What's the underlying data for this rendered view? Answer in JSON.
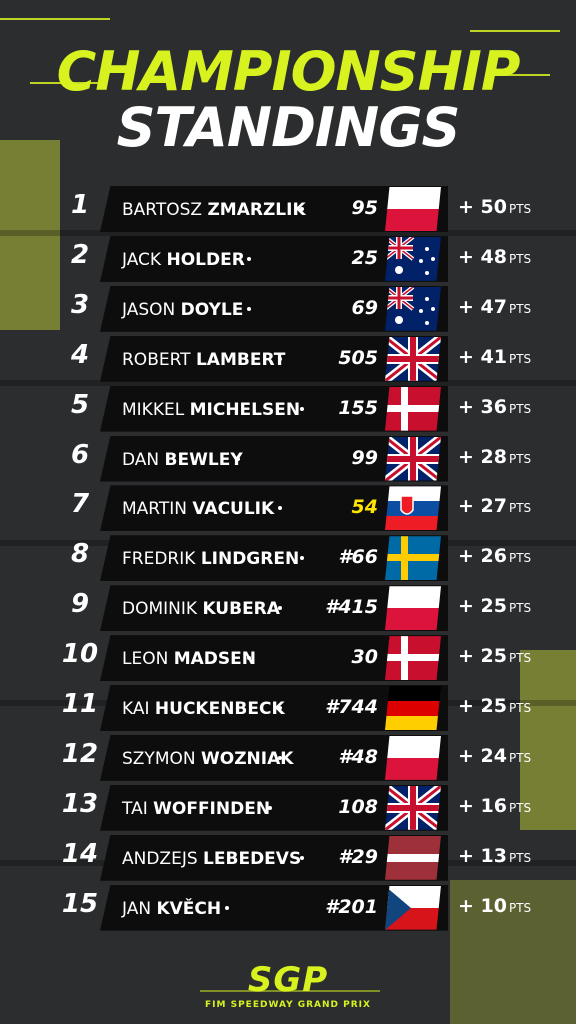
{
  "header": {
    "line1": "CHAMPIONSHIP",
    "line2": "STANDINGS"
  },
  "colors": {
    "accent": "#d7f21f",
    "bar": "#0d0d0d",
    "background": "#2b2d2f"
  },
  "standings": [
    {
      "rank": "1",
      "first": "BARTOSZ",
      "last": "ZMARZLIK",
      "number": "95",
      "flag": "poland",
      "points": "+ 50",
      "unit": "PTS"
    },
    {
      "rank": "2",
      "first": "JACK",
      "last": "HOLDER",
      "number": "25",
      "flag": "australia",
      "points": "+ 48",
      "unit": "PTS"
    },
    {
      "rank": "3",
      "first": "JASON",
      "last": "DOYLE",
      "number": "69",
      "flag": "australia",
      "points": "+ 47",
      "unit": "PTS"
    },
    {
      "rank": "4",
      "first": "ROBERT",
      "last": "LAMBERT",
      "number": "505",
      "flag": "uk",
      "points": "+ 41",
      "unit": "PTS"
    },
    {
      "rank": "5",
      "first": "MIKKEL",
      "last": "MICHELSEN",
      "number": "155",
      "flag": "denmark",
      "points": "+ 36",
      "unit": "PTS"
    },
    {
      "rank": "6",
      "first": "DAN",
      "last": "BEWLEY",
      "number": "99",
      "flag": "uk",
      "points": "+ 28",
      "unit": "PTS"
    },
    {
      "rank": "7",
      "first": "MARTIN",
      "last": "VACULIK",
      "number": "54",
      "flag": "slovakia",
      "points": "+ 27",
      "unit": "PTS"
    },
    {
      "rank": "8",
      "first": "FREDRIK",
      "last": "LINDGREN",
      "number": "#66",
      "flag": "sweden",
      "points": "+ 26",
      "unit": "PTS"
    },
    {
      "rank": "9",
      "first": "DOMINIK",
      "last": "KUBERA",
      "number": "#415",
      "flag": "poland",
      "points": "+ 25",
      "unit": "PTS"
    },
    {
      "rank": "10",
      "first": "LEON",
      "last": "MADSEN",
      "number": "30",
      "flag": "denmark",
      "points": "+ 25",
      "unit": "PTS"
    },
    {
      "rank": "11",
      "first": "KAI",
      "last": "HUCKENBECK",
      "number": "#744",
      "flag": "germany",
      "points": "+ 25",
      "unit": "PTS"
    },
    {
      "rank": "12",
      "first": "SZYMON",
      "last": "WOZNIAK",
      "number": "#48",
      "flag": "poland",
      "points": "+ 24",
      "unit": "PTS"
    },
    {
      "rank": "13",
      "first": "TAI",
      "last": "WOFFINDEN",
      "number": "108",
      "flag": "uk",
      "points": "+ 16",
      "unit": "PTS"
    },
    {
      "rank": "14",
      "first": "ANDZEJS",
      "last": "LEBEDEVS",
      "number": "#29",
      "flag": "latvia",
      "points": "+ 13",
      "unit": "PTS"
    },
    {
      "rank": "15",
      "first": "JAN",
      "last": "KVĚCH",
      "number": "#201",
      "flag": "czechia",
      "points": "+ 10",
      "unit": "PTS"
    }
  ],
  "footer": {
    "logo": "SGP",
    "tagline": "FIM SPEEDWAY GRAND PRIX"
  }
}
